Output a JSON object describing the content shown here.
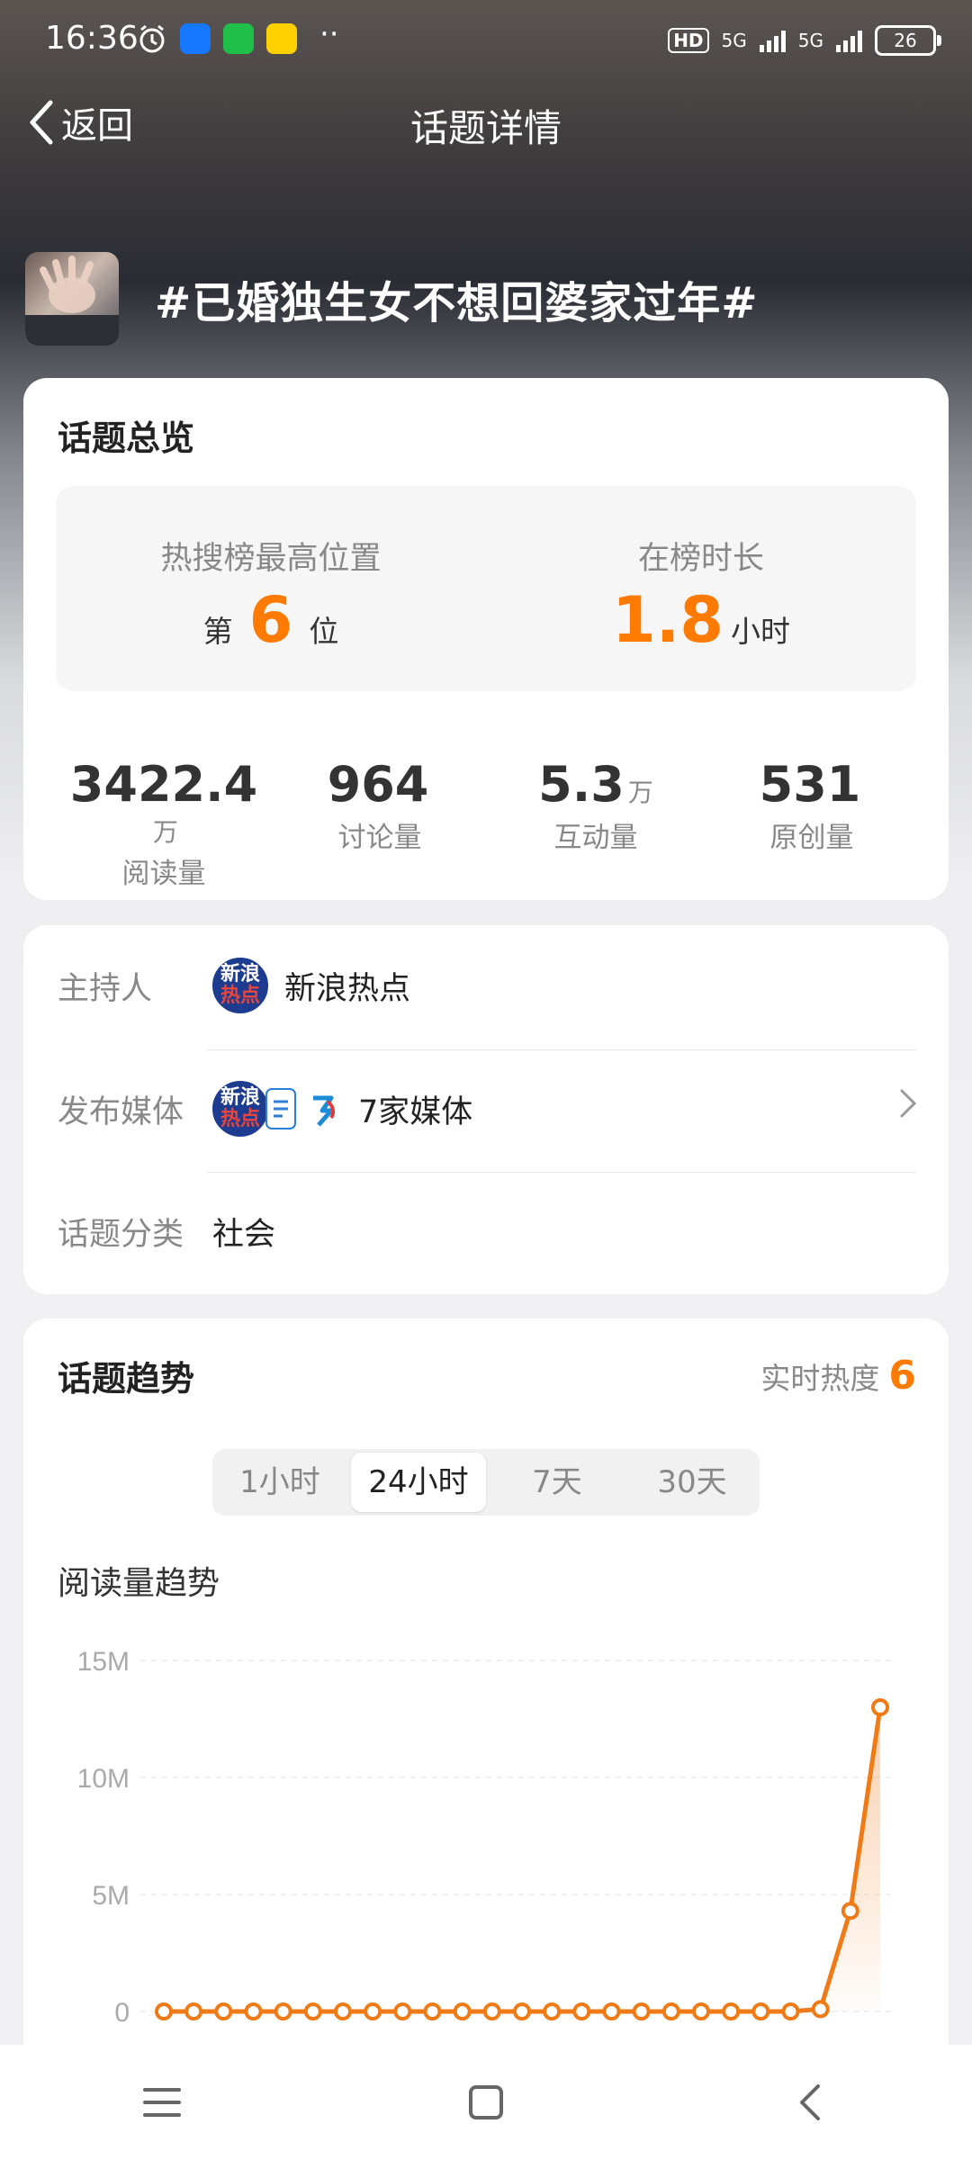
{
  "status_bar": {
    "time": "16:36",
    "network_1": "5G",
    "network_2": "5G",
    "battery": "26",
    "hd_label": "HD",
    "dots": "··"
  },
  "nav": {
    "back_label": "返回",
    "title": "话题详情"
  },
  "topic": {
    "title": "#已婚独生女不想回婆家过年#"
  },
  "overview": {
    "title": "话题总览",
    "highest_label": "热搜榜最高位置",
    "highest_prefix": "第",
    "highest_value": "6",
    "highest_suffix": "位",
    "duration_label": "在榜时长",
    "duration_value": "1.8",
    "duration_unit": "小时",
    "stats": [
      {
        "value": "3422.4",
        "unit": "万",
        "label": "阅读量"
      },
      {
        "value": "964",
        "unit": "",
        "label": "讨论量"
      },
      {
        "value": "5.3",
        "unit": "万",
        "label": "互动量"
      },
      {
        "value": "531",
        "unit": "",
        "label": "原创量"
      }
    ]
  },
  "info": {
    "host_label": "主持人",
    "host_name": "新浪热点",
    "media_label": "发布媒体",
    "media_value": "7家媒体",
    "category_label": "话题分类",
    "category_value": "社会",
    "logo_text_top": "新浪",
    "logo_text_bottom": "热点"
  },
  "trend": {
    "title": "话题趋势",
    "realtime_label": "实时热度",
    "realtime_value": "6",
    "tabs": [
      "1小时",
      "24小时",
      "7天",
      "30天"
    ],
    "active_tab": "24小时",
    "chart_title": "阅读量趋势"
  },
  "chart_data": {
    "type": "line",
    "title": "阅读量趋势",
    "ylabels": [
      "15M",
      "10M",
      "5M",
      "0"
    ],
    "ylim": [
      0,
      15
    ],
    "y_unit": "M",
    "values": [
      0,
      0,
      0,
      0,
      0,
      0,
      0,
      0,
      0,
      0,
      0,
      0,
      0,
      0,
      0,
      0,
      0,
      0,
      0,
      0,
      0,
      0,
      0.1,
      4.3,
      13
    ],
    "color": "#f07a16",
    "grid": true
  },
  "colors": {
    "accent": "#ff7a00",
    "line": "#f07a16"
  }
}
